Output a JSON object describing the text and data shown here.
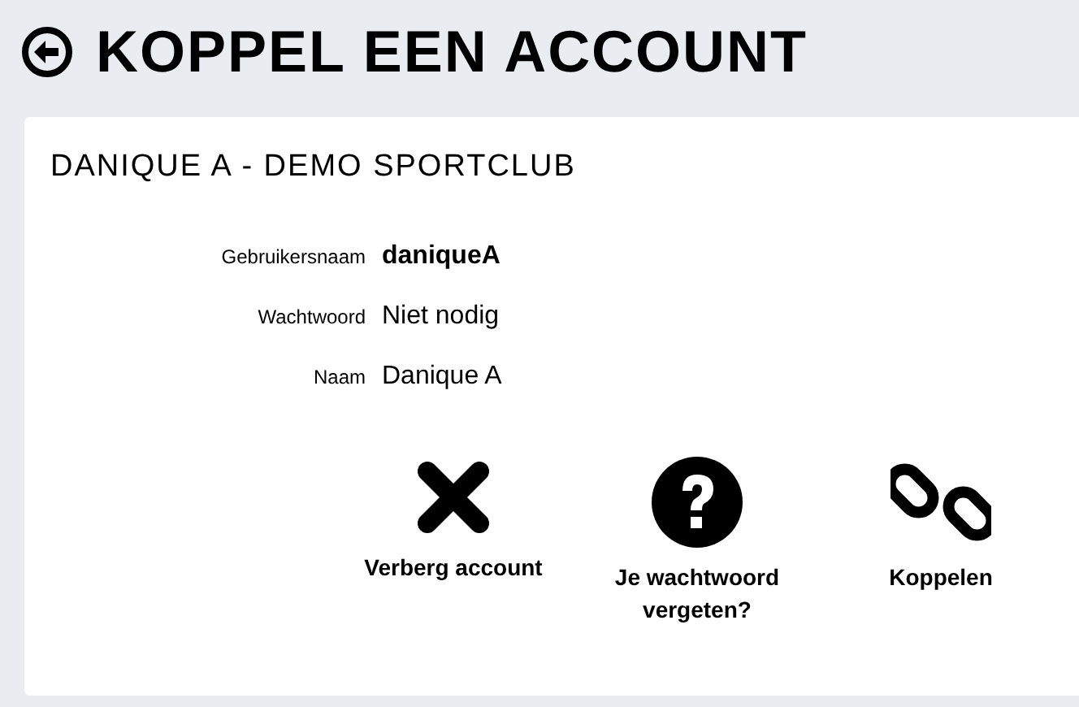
{
  "page": {
    "title": "KOPPEL EEN ACCOUNT"
  },
  "card": {
    "title": "DANIQUE A - DEMO SPORTCLUB",
    "fields": [
      {
        "label": "Gebruikersnaam",
        "value": "daniqueA",
        "bold": true
      },
      {
        "label": "Wachtwoord",
        "value": "Niet nodig",
        "bold": false
      },
      {
        "label": "Naam",
        "value": "Danique A",
        "bold": false
      }
    ],
    "actions": [
      {
        "kind": "hide",
        "label": "Verberg account"
      },
      {
        "kind": "help",
        "label": "Je wachtwoord vergeten?"
      },
      {
        "kind": "link",
        "label": "Koppelen"
      }
    ]
  }
}
